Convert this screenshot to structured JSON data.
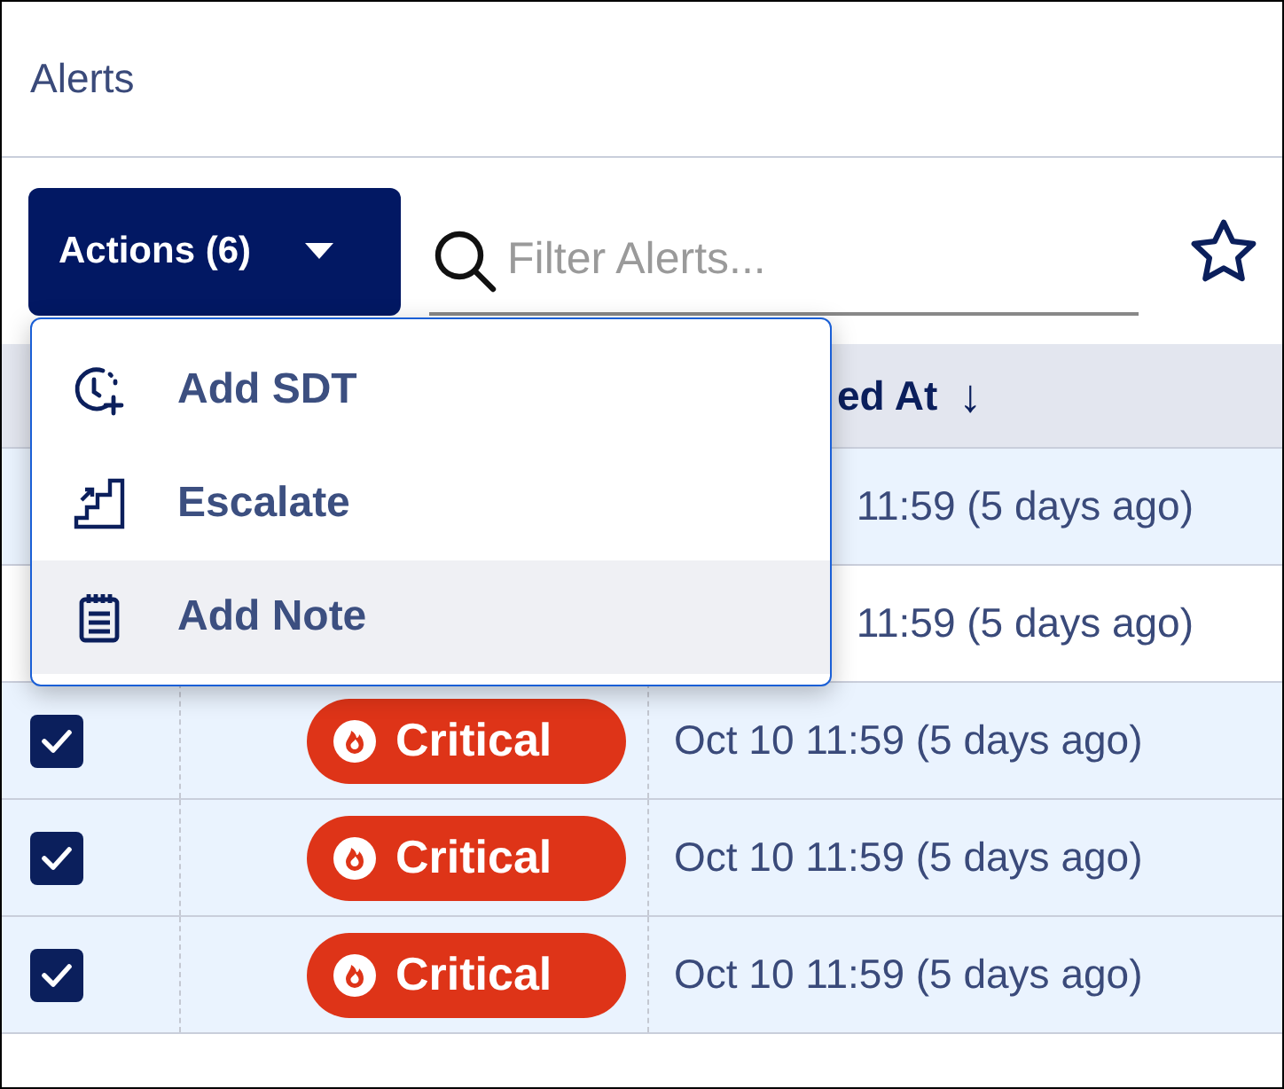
{
  "title": "Alerts",
  "actions_button": {
    "label": "Actions (6)"
  },
  "search": {
    "placeholder": "Filter Alerts..."
  },
  "favorite": {
    "on": false
  },
  "table": {
    "columns": [
      "ed At"
    ],
    "sort_arrow": "↓",
    "rows": [
      {
        "time": "11:59 (5 days ago)",
        "selected": true
      },
      {
        "time": "11:59 (5 days ago)",
        "selected": false
      },
      {
        "checked": true,
        "severity": "Critical",
        "time": "Oct 10 11:59 (5 days ago)",
        "selected": true
      },
      {
        "checked": true,
        "severity": "Critical",
        "time": "Oct 10 11:59 (5 days ago)",
        "selected": true
      },
      {
        "checked": true,
        "severity": "Critical",
        "time": "Oct 10 11:59 (5 days ago)",
        "selected": true
      }
    ]
  },
  "menu": {
    "items": [
      {
        "kind": "sdt",
        "label": "Add SDT",
        "selected": false
      },
      {
        "kind": "escalate",
        "label": "Escalate",
        "selected": false
      },
      {
        "kind": "note",
        "label": "Add Note",
        "selected": true
      }
    ]
  }
}
